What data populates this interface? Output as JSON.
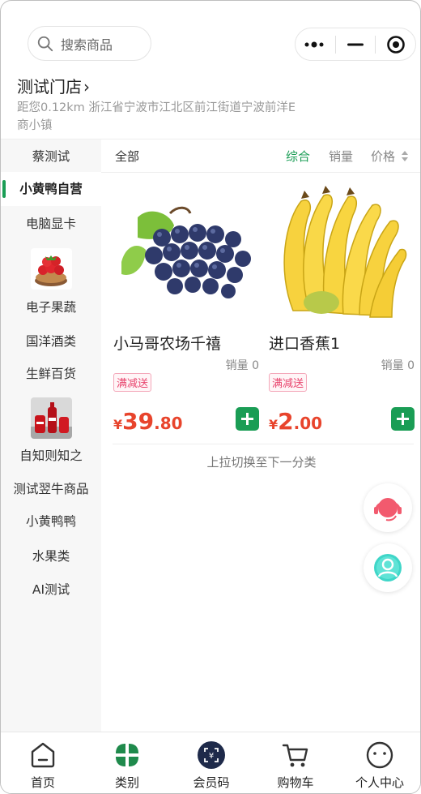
{
  "header": {
    "search_placeholder": "搜索商品",
    "store_name": "测试门店",
    "store_chevron": "›",
    "address": "距您0.12km 浙江省宁波市江北区前江街道宁波前洋E商小镇"
  },
  "sidebar": {
    "items": [
      {
        "label": "蔡测试"
      },
      {
        "label": "小黄鸭自营"
      },
      {
        "label": "电脑显卡"
      },
      {
        "label": "电子果蔬"
      },
      {
        "label": "国洋酒类"
      },
      {
        "label": "生鲜百货"
      },
      {
        "label": "自知则知之"
      },
      {
        "label": "测试翌牛商品"
      },
      {
        "label": "小黄鸭鸭"
      },
      {
        "label": "水果类"
      },
      {
        "label": "AI测试"
      }
    ],
    "active_index": 1
  },
  "sortbar": {
    "all": "全部",
    "comprehensive": "综合",
    "sales": "销量",
    "price": "价格"
  },
  "products": [
    {
      "name": "小马哥农场千禧",
      "sales": "销量 0",
      "tag": "满减送",
      "currency": "¥",
      "price_int": "39",
      "price_dec": ".80",
      "image": "grapes"
    },
    {
      "name": "进口香蕉1",
      "sales": "销量 0",
      "tag": "满减送",
      "currency": "¥",
      "price_int": "2",
      "price_dec": ".00",
      "image": "bananas"
    }
  ],
  "pull_hint": "上拉切换至下一分类",
  "tabbar": {
    "tabs": [
      {
        "label": "首页",
        "icon": "home-icon"
      },
      {
        "label": "类别",
        "icon": "category-icon"
      },
      {
        "label": "会员码",
        "icon": "member-code-icon"
      },
      {
        "label": "购物车",
        "icon": "cart-icon"
      },
      {
        "label": "个人中心",
        "icon": "profile-icon"
      }
    ]
  },
  "colors": {
    "accent": "#1a9d55",
    "price": "#e8442c",
    "tag": "#e8436c"
  }
}
